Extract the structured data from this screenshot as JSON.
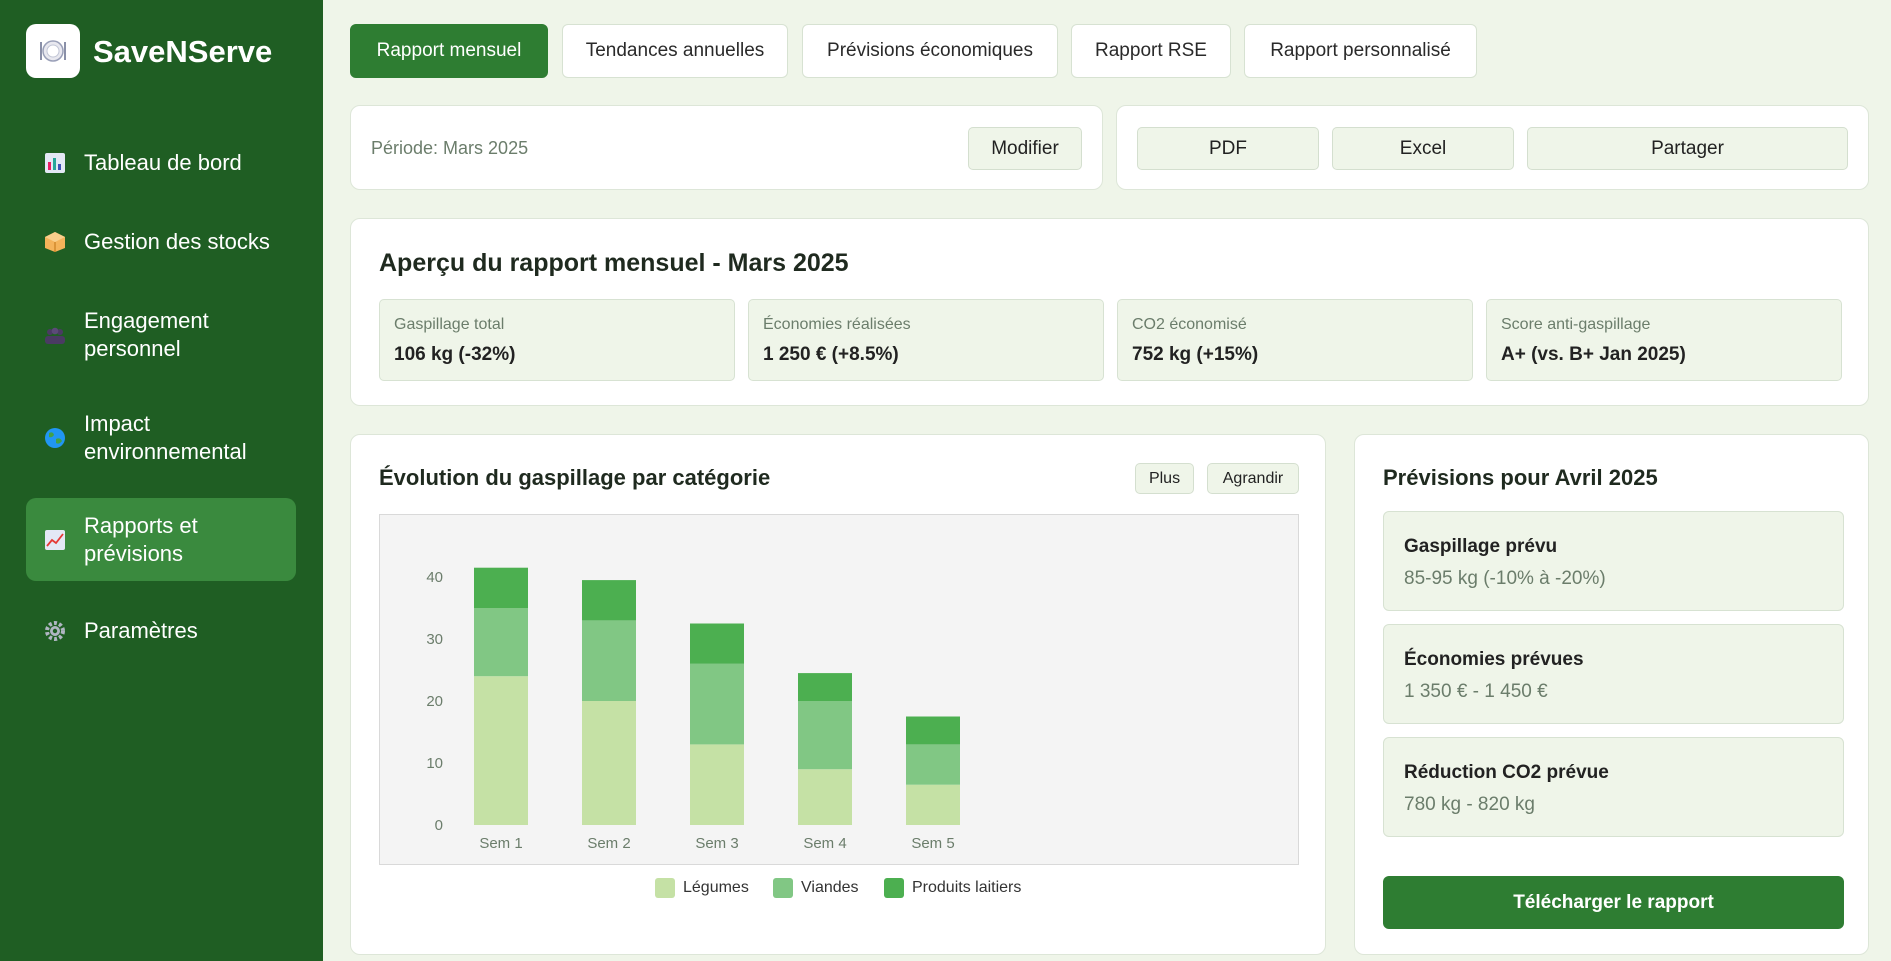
{
  "app": {
    "name": "SaveNServe",
    "logo_icon": "plate-cutlery-icon"
  },
  "sidebar": {
    "items": [
      {
        "label": "Tableau de bord",
        "icon": "bar-chart-icon"
      },
      {
        "label": "Gestion des stocks",
        "icon": "package-icon"
      },
      {
        "label": "Engagement personnel",
        "icon": "team-icon"
      },
      {
        "label": "Impact environnemental",
        "icon": "globe-icon"
      },
      {
        "label": "Rapports et prévisions",
        "icon": "chart-up-icon",
        "active": true
      },
      {
        "label": "Paramètres",
        "icon": "gear-icon"
      }
    ]
  },
  "tabs": [
    {
      "label": "Rapport mensuel",
      "active": true
    },
    {
      "label": "Tendances annuelles"
    },
    {
      "label": "Prévisions économiques"
    },
    {
      "label": "Rapport RSE"
    },
    {
      "label": "Rapport personnalisé"
    }
  ],
  "period": {
    "text": "Période: Mars 2025",
    "modify_label": "Modifier"
  },
  "export": {
    "pdf": "PDF",
    "excel": "Excel",
    "share": "Partager"
  },
  "overview": {
    "title": "Aperçu du rapport mensuel - Mars 2025",
    "stats": [
      {
        "label": "Gaspillage total",
        "value": "106 kg (-32%)"
      },
      {
        "label": "Économies réalisées",
        "value": "1 250 € (+8.5%)"
      },
      {
        "label": "CO2 économisé",
        "value": "752 kg (+15%)"
      },
      {
        "label": "Score anti-gaspillage",
        "value": "A+ (vs. B+ Jan 2025)"
      }
    ]
  },
  "chart_card": {
    "title": "Évolution du gaspillage par catégorie",
    "more_label": "Plus",
    "expand_label": "Agrandir"
  },
  "chart_data": {
    "type": "bar",
    "stacked": true,
    "title": "Évolution du gaspillage par catégorie",
    "categories": [
      "Sem 1",
      "Sem 2",
      "Sem 3",
      "Sem 4",
      "Sem 5"
    ],
    "series": [
      {
        "name": "Légumes",
        "values": [
          24,
          20,
          13,
          9,
          6.5
        ],
        "color": "#c5e1a5"
      },
      {
        "name": "Viandes",
        "values": [
          11,
          13,
          13,
          11,
          6.5
        ],
        "color": "#81c784"
      },
      {
        "name": "Produits laitiers",
        "values": [
          6.5,
          6.5,
          6.5,
          4.5,
          4.5
        ],
        "color": "#4caf50"
      }
    ],
    "yticks": [
      "0",
      "10",
      "20",
      "30",
      "40"
    ],
    "ylim": [
      0,
      40
    ],
    "legend": "bottom"
  },
  "forecast": {
    "title": "Prévisions pour Avril 2025",
    "items": [
      {
        "label": "Gaspillage prévu",
        "value": "85-95 kg (-10% à -20%)"
      },
      {
        "label": "Économies prévues",
        "value": "1 350 € - 1 450 €"
      },
      {
        "label": "Réduction CO2 prévue",
        "value": "780 kg - 820 kg"
      }
    ],
    "download_label": "Télécharger le rapport"
  },
  "colors": {
    "sidebar": "#1f5e23",
    "accent": "#2e7d32",
    "active_nav": "#3a8a3e",
    "background": "#eff5e9"
  }
}
